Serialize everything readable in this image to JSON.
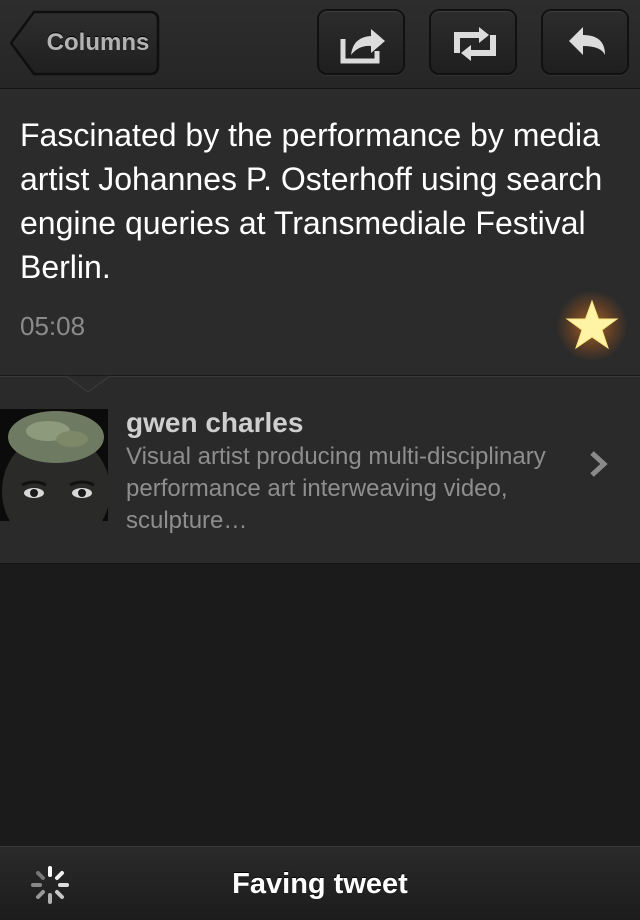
{
  "toolbar": {
    "back_label": "Columns",
    "icons": [
      "share-icon",
      "retweet-icon",
      "reply-icon"
    ]
  },
  "tweet": {
    "text": "Fascinated by the performance by media artist Johannes P. Osterhoff using search engine queries at Transmediale Festival Berlin.",
    "time": "05:08",
    "favorited": true,
    "star_color": "#fff3a6"
  },
  "profile": {
    "name": "gwen charles",
    "bio": "Visual artist producing multi-disciplinary performance art interweaving video, sculpture…"
  },
  "status": {
    "text": "Faving tweet"
  }
}
